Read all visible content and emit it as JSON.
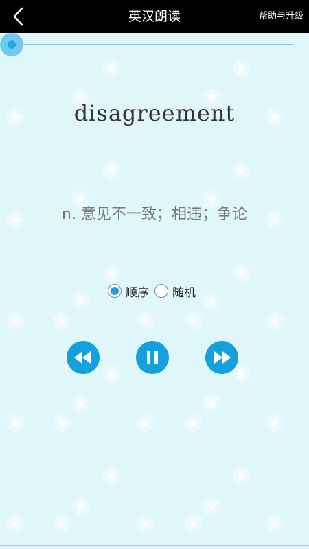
{
  "header": {
    "back_icon": "chevron-left-icon",
    "title": "英汉朗读",
    "help_label": "帮助与升级"
  },
  "playback": {
    "progress": 0.0
  },
  "card": {
    "word": "disagreement",
    "meaning": "n. 意见不一致；相违；争论"
  },
  "modes": {
    "options": [
      {
        "label": "顺序",
        "selected": true
      },
      {
        "label": "随机",
        "selected": false
      }
    ]
  },
  "controls": {
    "rewind_icon": "rewind-icon",
    "pause_icon": "pause-icon",
    "fast_forward_icon": "fast-forward-icon"
  },
  "colors": {
    "background": "#dff6fa",
    "accent": "#14a0dc",
    "topbar": "#000000"
  }
}
